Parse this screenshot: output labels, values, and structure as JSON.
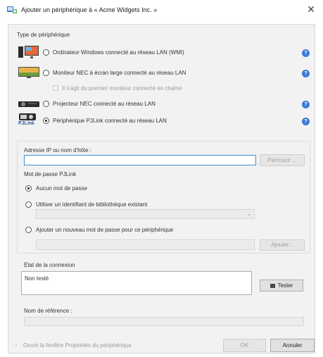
{
  "window": {
    "title": "Ajouter un périphérique à « Acme Widgets Inc. »",
    "close_glyph": "✕"
  },
  "device_type": {
    "label": "Type de périphérique",
    "options": [
      {
        "label": "Ordinateur Windows connecté au réseau LAN (WMI)",
        "selected": false,
        "icon": "windows-computer-icon"
      },
      {
        "label": "Moniteur NEC à écran large connecté au réseau LAN",
        "selected": false,
        "icon": "nec-monitor-icon"
      },
      {
        "label": "Projecteur NEC connecté au réseau LAN",
        "selected": false,
        "icon": "nec-projector-icon"
      },
      {
        "label": "Périphérique PJLink connecté au réseau LAN",
        "selected": true,
        "icon": "pjlink-icon"
      }
    ],
    "chained_checkbox_label": "Il s'agit du premier moniteur connecté en chaîne",
    "pjlink_logo_text": "PJLink",
    "help_glyph": "?"
  },
  "address": {
    "label": "Adresse IP ou nom d'hôte :",
    "value": "",
    "browse_button": "Parcourir ..."
  },
  "password": {
    "label": "Mot de passe PJLink",
    "options": [
      {
        "label": "Aucun mot de passe",
        "selected": true
      },
      {
        "label": "Utiliser un identifiant de bibliothèque existant",
        "selected": false
      },
      {
        "label": "Ajouter un nouveau mot de passe pour ce périphérique",
        "selected": false
      }
    ],
    "dropdown_value": "",
    "new_password_value": "",
    "add_button": "Ajouter..."
  },
  "connection": {
    "label": "État de la connexion",
    "status_text": "Non testé",
    "test_button": "Tester"
  },
  "reference": {
    "label": "Nom de référence :",
    "value": ""
  },
  "footer": {
    "open_properties_label": "Ouvrir la fenêtre Propriétés du périphérique",
    "ok_button": "OK",
    "cancel_button": "Annuler"
  },
  "colors": {
    "accent_blue": "#3d7ad8",
    "focus_border": "#3b8fd6"
  }
}
